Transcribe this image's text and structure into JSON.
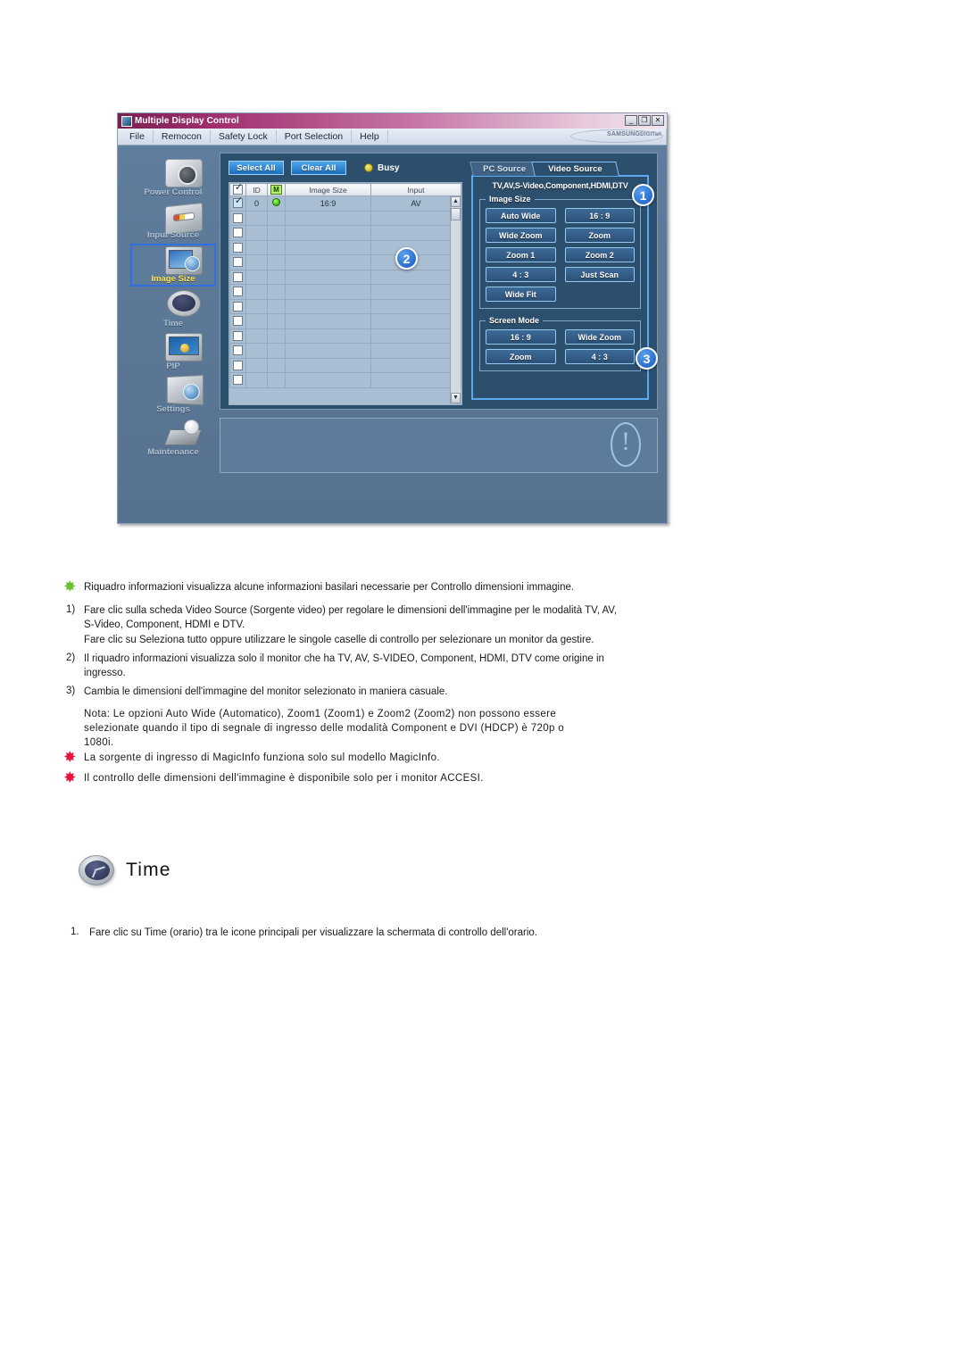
{
  "app": {
    "title": "Multiple Display Control",
    "titlebar_buttons": [
      {
        "name": "minimize",
        "glyph": "_"
      },
      {
        "name": "maximize",
        "glyph": "❐"
      },
      {
        "name": "close",
        "glyph": "✕"
      }
    ],
    "menu": [
      "File",
      "Remocon",
      "Safety Lock",
      "Port Selection",
      "Help"
    ],
    "brand": "SAMSUNG",
    "brand_sub": "DIGITall",
    "sidebar": [
      {
        "label": "Power Control",
        "icon": "power-control-icon",
        "selected": false
      },
      {
        "label": "Input Source",
        "icon": "input-source-icon",
        "selected": false
      },
      {
        "label": "Image Size",
        "icon": "image-size-icon",
        "selected": true
      },
      {
        "label": "Time",
        "icon": "time-icon",
        "selected": false
      },
      {
        "label": "PIP",
        "icon": "pip-icon",
        "selected": false
      },
      {
        "label": "Settings",
        "icon": "settings-icon",
        "selected": false
      },
      {
        "label": "Maintenance",
        "icon": "maintenance-icon",
        "selected": false
      }
    ],
    "toolbar": {
      "select_all": "Select All",
      "clear_all": "Clear All",
      "busy_label": "Busy"
    },
    "table": {
      "headers": [
        "",
        "ID",
        "M",
        "Image Size",
        "Input"
      ],
      "rows": [
        {
          "checked": true,
          "id": "0",
          "power": "on",
          "image_size": "16:9",
          "input": "AV"
        },
        {
          "checked": false,
          "id": "",
          "power": "",
          "image_size": "",
          "input": ""
        },
        {
          "checked": false,
          "id": "",
          "power": "",
          "image_size": "",
          "input": ""
        },
        {
          "checked": false,
          "id": "",
          "power": "",
          "image_size": "",
          "input": ""
        },
        {
          "checked": false,
          "id": "",
          "power": "",
          "image_size": "",
          "input": ""
        },
        {
          "checked": false,
          "id": "",
          "power": "",
          "image_size": "",
          "input": ""
        },
        {
          "checked": false,
          "id": "",
          "power": "",
          "image_size": "",
          "input": ""
        },
        {
          "checked": false,
          "id": "",
          "power": "",
          "image_size": "",
          "input": ""
        },
        {
          "checked": false,
          "id": "",
          "power": "",
          "image_size": "",
          "input": ""
        },
        {
          "checked": false,
          "id": "",
          "power": "",
          "image_size": "",
          "input": ""
        },
        {
          "checked": false,
          "id": "",
          "power": "",
          "image_size": "",
          "input": ""
        },
        {
          "checked": false,
          "id": "",
          "power": "",
          "image_size": "",
          "input": ""
        },
        {
          "checked": false,
          "id": "",
          "power": "",
          "image_size": "",
          "input": ""
        }
      ],
      "scroll_up": "▲",
      "scroll_down": "▼"
    },
    "tabs": [
      {
        "label": "PC Source",
        "active": false
      },
      {
        "label": "Video Source",
        "active": true
      }
    ],
    "source_caption": "TV,AV,S-Video,Component,HDMI,DTV",
    "image_size_group": {
      "legend": "Image Size",
      "buttons": [
        "Auto Wide",
        "16 : 9",
        "Wide Zoom",
        "Zoom",
        "Zoom 1",
        "Zoom 2",
        "4 : 3",
        "Just Scan",
        "Wide Fit"
      ]
    },
    "screen_mode_group": {
      "legend": "Screen Mode",
      "buttons": [
        "16 : 9",
        "Wide Zoom",
        "Zoom",
        "4 : 3"
      ]
    },
    "badges": [
      "1",
      "2",
      "3"
    ],
    "accent_color": "#1458c2",
    "titlebar_color": "#a0306e",
    "panel_color": "#2d4f6e"
  },
  "doc": {
    "bullet1": "Riquadro informazioni visualizza alcune informazioni basilari necessarie per Controllo dimensioni immagine.",
    "item1_num": "1)",
    "item1_line1": "Fare clic sulla scheda Video Source (Sorgente video) per regolare le dimensioni dell'immagine per le modalità TV, AV,",
    "item1_line2": "S-Video, Component, HDMI e DTV.",
    "item1_line3": "Fare clic su Seleziona tutto oppure utilizzare le singole caselle di controllo per selezionare un monitor da gestire.",
    "item2_num": "2)",
    "item2_line1": "Il riquadro informazioni visualizza solo il monitor che ha TV, AV, S-VIDEO, Component, HDMI, DTV come origine in",
    "item2_line2": "ingresso.",
    "item3_num": "3)",
    "item3_line1": "Cambia le dimensioni dell'immagine del monitor selezionato in maniera casuale.",
    "note_line1": "Nota: Le opzioni Auto Wide (Automatico), Zoom1 (Zoom1) e Zoom2 (Zoom2) non possono essere",
    "note_line2": "selezionate quando il tipo di segnale di ingresso delle modalità Component e DVI (HDCP) è 720p o",
    "note_line3": "1080i.",
    "bullet2": "La sorgente di ingresso di MagicInfo funziona solo sul modello MagicInfo.",
    "bullet3": "Il controllo delle dimensioni dell'immagine è disponibile solo per i monitor ACCESI.",
    "section_title": "Time",
    "section_item1_num": "1.",
    "section_item1_text": "Fare clic su Time (orario) tra le icone principali per visualizzare la schermata di controllo dell'orario."
  }
}
